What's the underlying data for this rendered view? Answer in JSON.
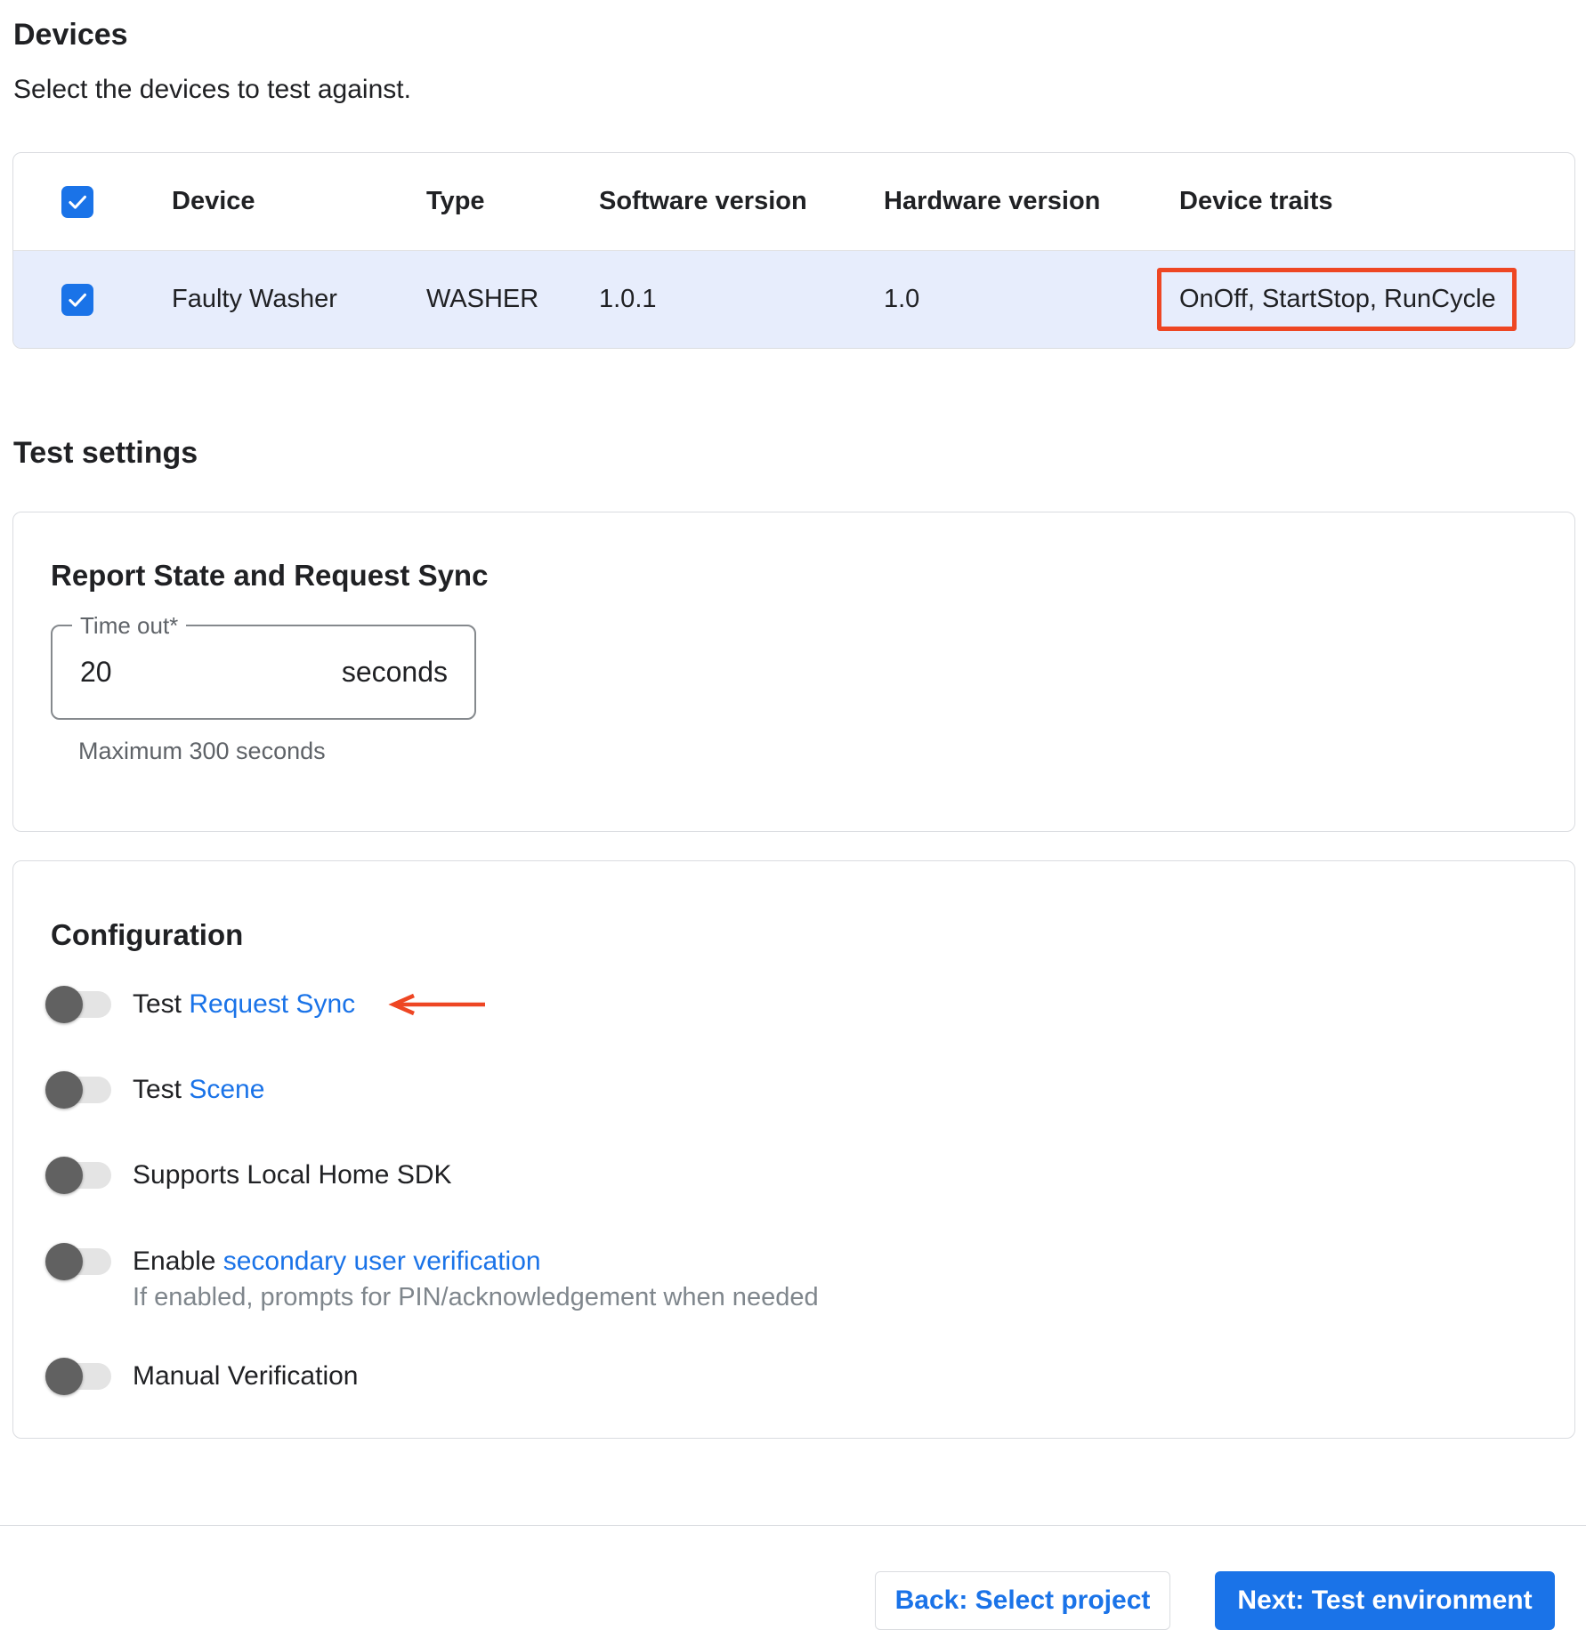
{
  "devices_section": {
    "title": "Devices",
    "subtitle": "Select the devices to test against.",
    "table": {
      "columns": {
        "device": "Device",
        "type": "Type",
        "software_version": "Software version",
        "hardware_version": "Hardware version",
        "device_traits": "Device traits"
      },
      "header_checkbox_checked": true,
      "rows": [
        {
          "selected": true,
          "device": "Faulty Washer",
          "type": "WASHER",
          "software_version": "1.0.1",
          "hardware_version": "1.0",
          "device_traits": "OnOff, StartStop, RunCycle",
          "traits_annotated": true
        }
      ]
    }
  },
  "test_settings_section": {
    "title": "Test settings",
    "report_state_card": {
      "title": "Report State and Request Sync",
      "timeout_field": {
        "label": "Time out*",
        "value": "20",
        "unit": "seconds",
        "helper": "Maximum 300 seconds"
      }
    },
    "configuration_card": {
      "title": "Configuration",
      "toggles": [
        {
          "prefix": "Test ",
          "link": "Request Sync",
          "enabled": false,
          "annotated_with_arrow": true
        },
        {
          "prefix": "Test ",
          "link": "Scene",
          "enabled": false
        },
        {
          "label": "Supports Local Home SDK",
          "enabled": false
        },
        {
          "prefix": "Enable ",
          "link": "secondary user verification",
          "enabled": false,
          "description": "If enabled, prompts for PIN/acknowledgement when needed"
        },
        {
          "label": "Manual Verification",
          "enabled": false
        }
      ]
    }
  },
  "footer": {
    "back_label": "Back: Select project",
    "next_label": "Next: Test environment"
  },
  "colors": {
    "accent_blue": "#1a73e8",
    "annotation_red": "#ee4623",
    "selected_row": "#e7edfc",
    "toggle_thumb": "#616161",
    "text_primary": "#202124",
    "text_secondary": "#5f6368"
  }
}
